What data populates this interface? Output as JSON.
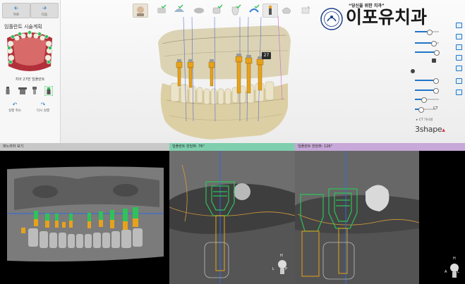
{
  "nav": {
    "back_label": "뒤로",
    "next_label": "다음"
  },
  "left_panel": {
    "title": "임플란트 시술계획",
    "selected_implant": "치아 27번 임플란트",
    "undo_label": "실행 취소",
    "redo_label": "다시 실행"
  },
  "tooth_label": "27",
  "branding": {
    "slogan": "“당신을 위한 치과”",
    "clinic_name": "이포유치과",
    "vendor": "3shape"
  },
  "right_panel": {
    "ct_label": "CT",
    "ct_option_label": "CT 가시성"
  },
  "panes": {
    "panorama_title": "파노라마 보기",
    "cross1_title": "임플란트 한담뷰: 76°",
    "cross2_title": "임플란트 한담뷰: 126°"
  },
  "orientation": {
    "cross1": {
      "top": "H",
      "left": "L",
      "right": "P"
    },
    "cross2": {
      "top": "H",
      "left": "A",
      "right": "L"
    }
  },
  "colors": {
    "accent": "#1e76c9",
    "cross1_header": "#7fcfae",
    "cross2_header": "#c7a8d8",
    "panorama_header": "#c8c8c8",
    "implant_green": "#2ec25a",
    "implant_orange": "#e7a21b"
  }
}
